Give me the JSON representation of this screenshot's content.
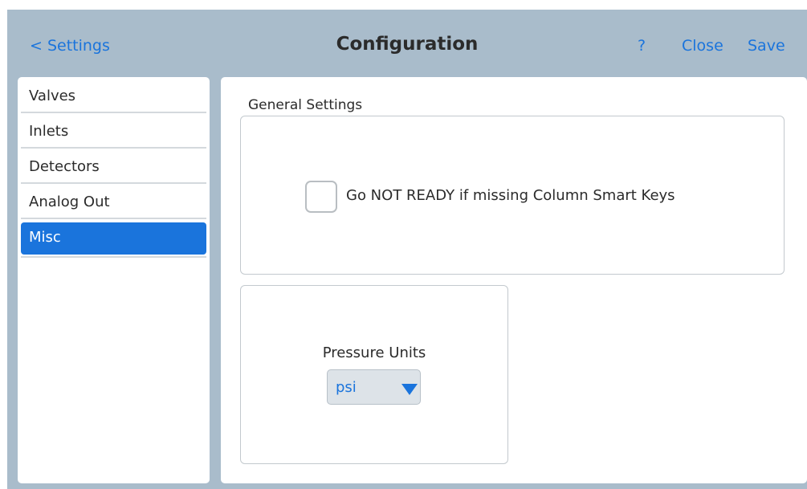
{
  "header": {
    "back_label": "< Settings",
    "title": "Configuration",
    "help_label": "?",
    "close_label": "Close",
    "save_label": "Save"
  },
  "sidebar": {
    "items": [
      {
        "label": "Valves",
        "active": false
      },
      {
        "label": "Inlets",
        "active": false
      },
      {
        "label": "Detectors",
        "active": false
      },
      {
        "label": "Analog Out",
        "active": false
      },
      {
        "label": "Misc",
        "active": true
      }
    ]
  },
  "main": {
    "general_settings": {
      "label": "General Settings",
      "checkbox_label": "Go NOT READY if missing Column Smart Keys",
      "checked": false
    },
    "pressure": {
      "label": "Pressure Units",
      "selected": "psi"
    }
  },
  "colors": {
    "accent": "#1a74dc",
    "background": "#a9bccb",
    "panel": "#ffffff"
  },
  "icons": {
    "dropdown": "triangle-down-icon"
  }
}
